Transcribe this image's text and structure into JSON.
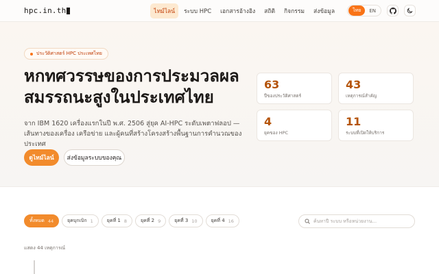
{
  "header": {
    "logo": "hpc.in.th",
    "nav": [
      {
        "label": "ไทม์ไลน์",
        "active": true
      },
      {
        "label": "ระบบ HPC",
        "active": false
      },
      {
        "label": "เอกสารอ้างอิง",
        "active": false
      },
      {
        "label": "สถิติ",
        "active": false
      },
      {
        "label": "กิจกรรม",
        "active": false
      },
      {
        "label": "ส่งข้อมูล",
        "active": false
      }
    ],
    "lang": {
      "th": "ไทย",
      "en": "EN"
    },
    "icons": {
      "github": "github-icon",
      "theme": "moon-icon"
    }
  },
  "hero": {
    "badge": "ประวัติศาสตร์ HPC ประเทศไทย",
    "title": "หกทศวรรษของการประมวลผลสมรรถนะสูงในประเทศไทย",
    "subtitle": "จาก IBM 1620 เครื่องแรกในปี พ.ศ. 2506 สู่ยุค AI-HPC ระดับเพตาฟลอป — เส้นทางของเครื่อง เครือข่าย และผู้คนที่สร้างโครงสร้างพื้นฐานการคำนวณของประเทศ",
    "primary_button": "ดูไทม์ไลน์",
    "secondary_button": "ส่งข้อมูลระบบของคุณ",
    "stats": [
      {
        "value": "63",
        "label": "ปีของประวัติศาสตร์"
      },
      {
        "value": "43",
        "label": "เหตุการณ์สำคัญ"
      },
      {
        "value": "4",
        "label": "ยุคของ HPC"
      },
      {
        "value": "11",
        "label": "ระบบที่เปิดให้บริการ"
      }
    ]
  },
  "filters": {
    "chips": [
      {
        "label": "ทั้งหมด",
        "count": "44",
        "active": true
      },
      {
        "label": "ยุคบุกเบิก",
        "count": "1",
        "active": false
      },
      {
        "label": "ยุคที่ 1",
        "count": "8",
        "active": false
      },
      {
        "label": "ยุคที่ 2",
        "count": "9",
        "active": false
      },
      {
        "label": "ยุคที่ 3",
        "count": "10",
        "active": false
      },
      {
        "label": "ยุคที่ 4",
        "count": "16",
        "active": false
      }
    ],
    "search_placeholder": "ค้นหาปี ระบบ หรือหน่วยงาน..."
  },
  "results_count": "แสดง 44 เหตุการณ์",
  "colors": {
    "accent": "#f28b2c",
    "stat_number": "#b45309"
  }
}
